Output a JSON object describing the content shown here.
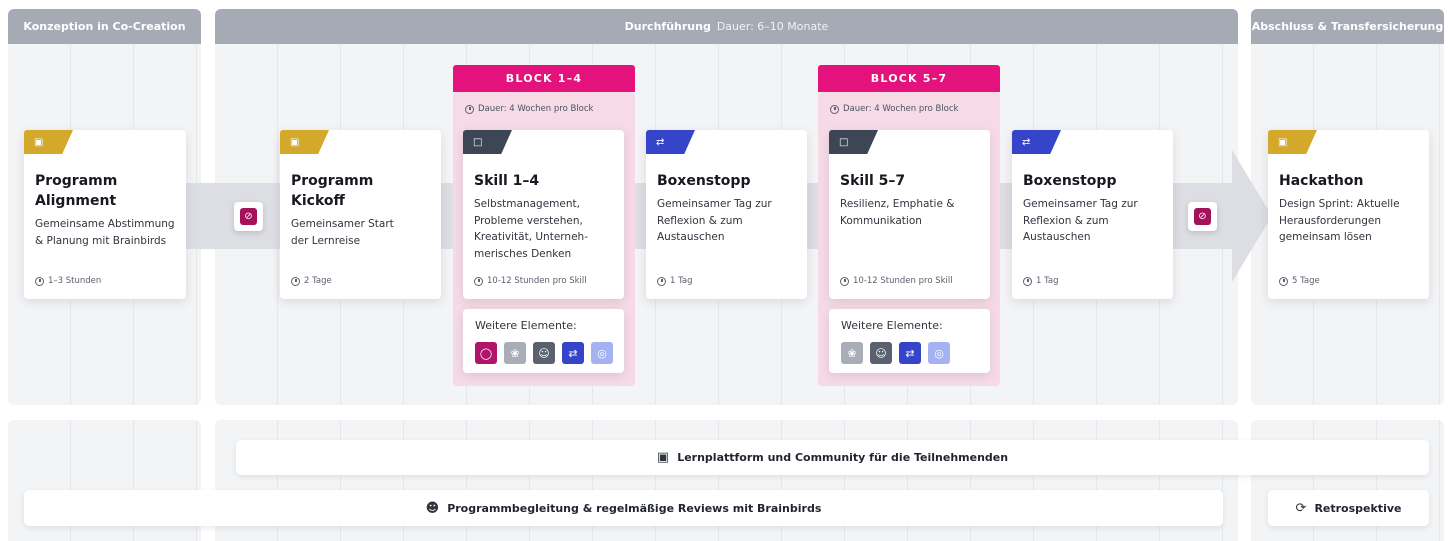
{
  "phases": {
    "konzeption": {
      "title": "Konzeption in Co-Creation"
    },
    "durchfuehrung": {
      "title": "Durchführung",
      "duration": "Dauer: 6–10 Monate"
    },
    "abschluss": {
      "title": "Abschluss & Transfersicherung"
    }
  },
  "blocks": [
    {
      "label": "BLOCK 1–4",
      "duration": "Dauer: 4 Wochen pro Block"
    },
    {
      "label": "BLOCK 5–7",
      "duration": "Dauer: 4 Wochen pro Block"
    }
  ],
  "cards": [
    {
      "icon": "calendar-icon",
      "title": "Programm Alignment",
      "desc": "Gemeinsame Abstimmung & Planung mit Brainbirds",
      "time": "1–3 Stunden"
    },
    {
      "icon": "calendar-icon",
      "title": "Programm Kickoff",
      "desc": "Gemeinsamer Start der Lernreise",
      "time": "2 Tage"
    },
    {
      "icon": "monitor-icon",
      "title": "Skill 1–4",
      "desc": "Selbstmanagement, Probleme verstehen, Kreativität, Unterneh-merisches Denken",
      "time": "10-12 Stunden pro Skill"
    },
    {
      "icon": "swap-icon",
      "title": "Boxenstopp",
      "desc": "Gemeinsamer Tag zur Reflexion & zum Austauschen",
      "time": "1 Tag"
    },
    {
      "icon": "monitor-icon",
      "title": "Skill 5–7",
      "desc": "Resilienz, Emphatie & Kommunikation",
      "time": "10-12 Stunden pro Skill"
    },
    {
      "icon": "swap-icon",
      "title": "Boxenstopp",
      "desc": "Gemeinsamer Tag zur Reflexion & zum Austauschen",
      "time": "1 Tag"
    },
    {
      "icon": "calendar-icon",
      "title": "Hackathon",
      "desc": "Design Sprint: Aktuelle Herausforderungen gemeinsam lösen",
      "time": "5 Tage"
    }
  ],
  "further": [
    {
      "label": "Weitere Elemente:"
    },
    {
      "label": "Weitere Elemente:"
    }
  ],
  "milestones": [
    "compass-icon",
    "compass-icon"
  ],
  "bars": {
    "lernplattform": "Lernplattform und Community für die Teilnehmenden",
    "begleitung": "Programmbegleitung & regelmäßige Reviews mit Brainbirds",
    "retrospektive": "Retrospektive"
  },
  "colors": {
    "block_accent": "#e4127c",
    "milestone": "#a3135c",
    "tag_calendar": "#d4a82a",
    "tag_monitor": "#3d4654",
    "tag_swap": "#3544c8",
    "phase_header": "#a5aab5"
  }
}
